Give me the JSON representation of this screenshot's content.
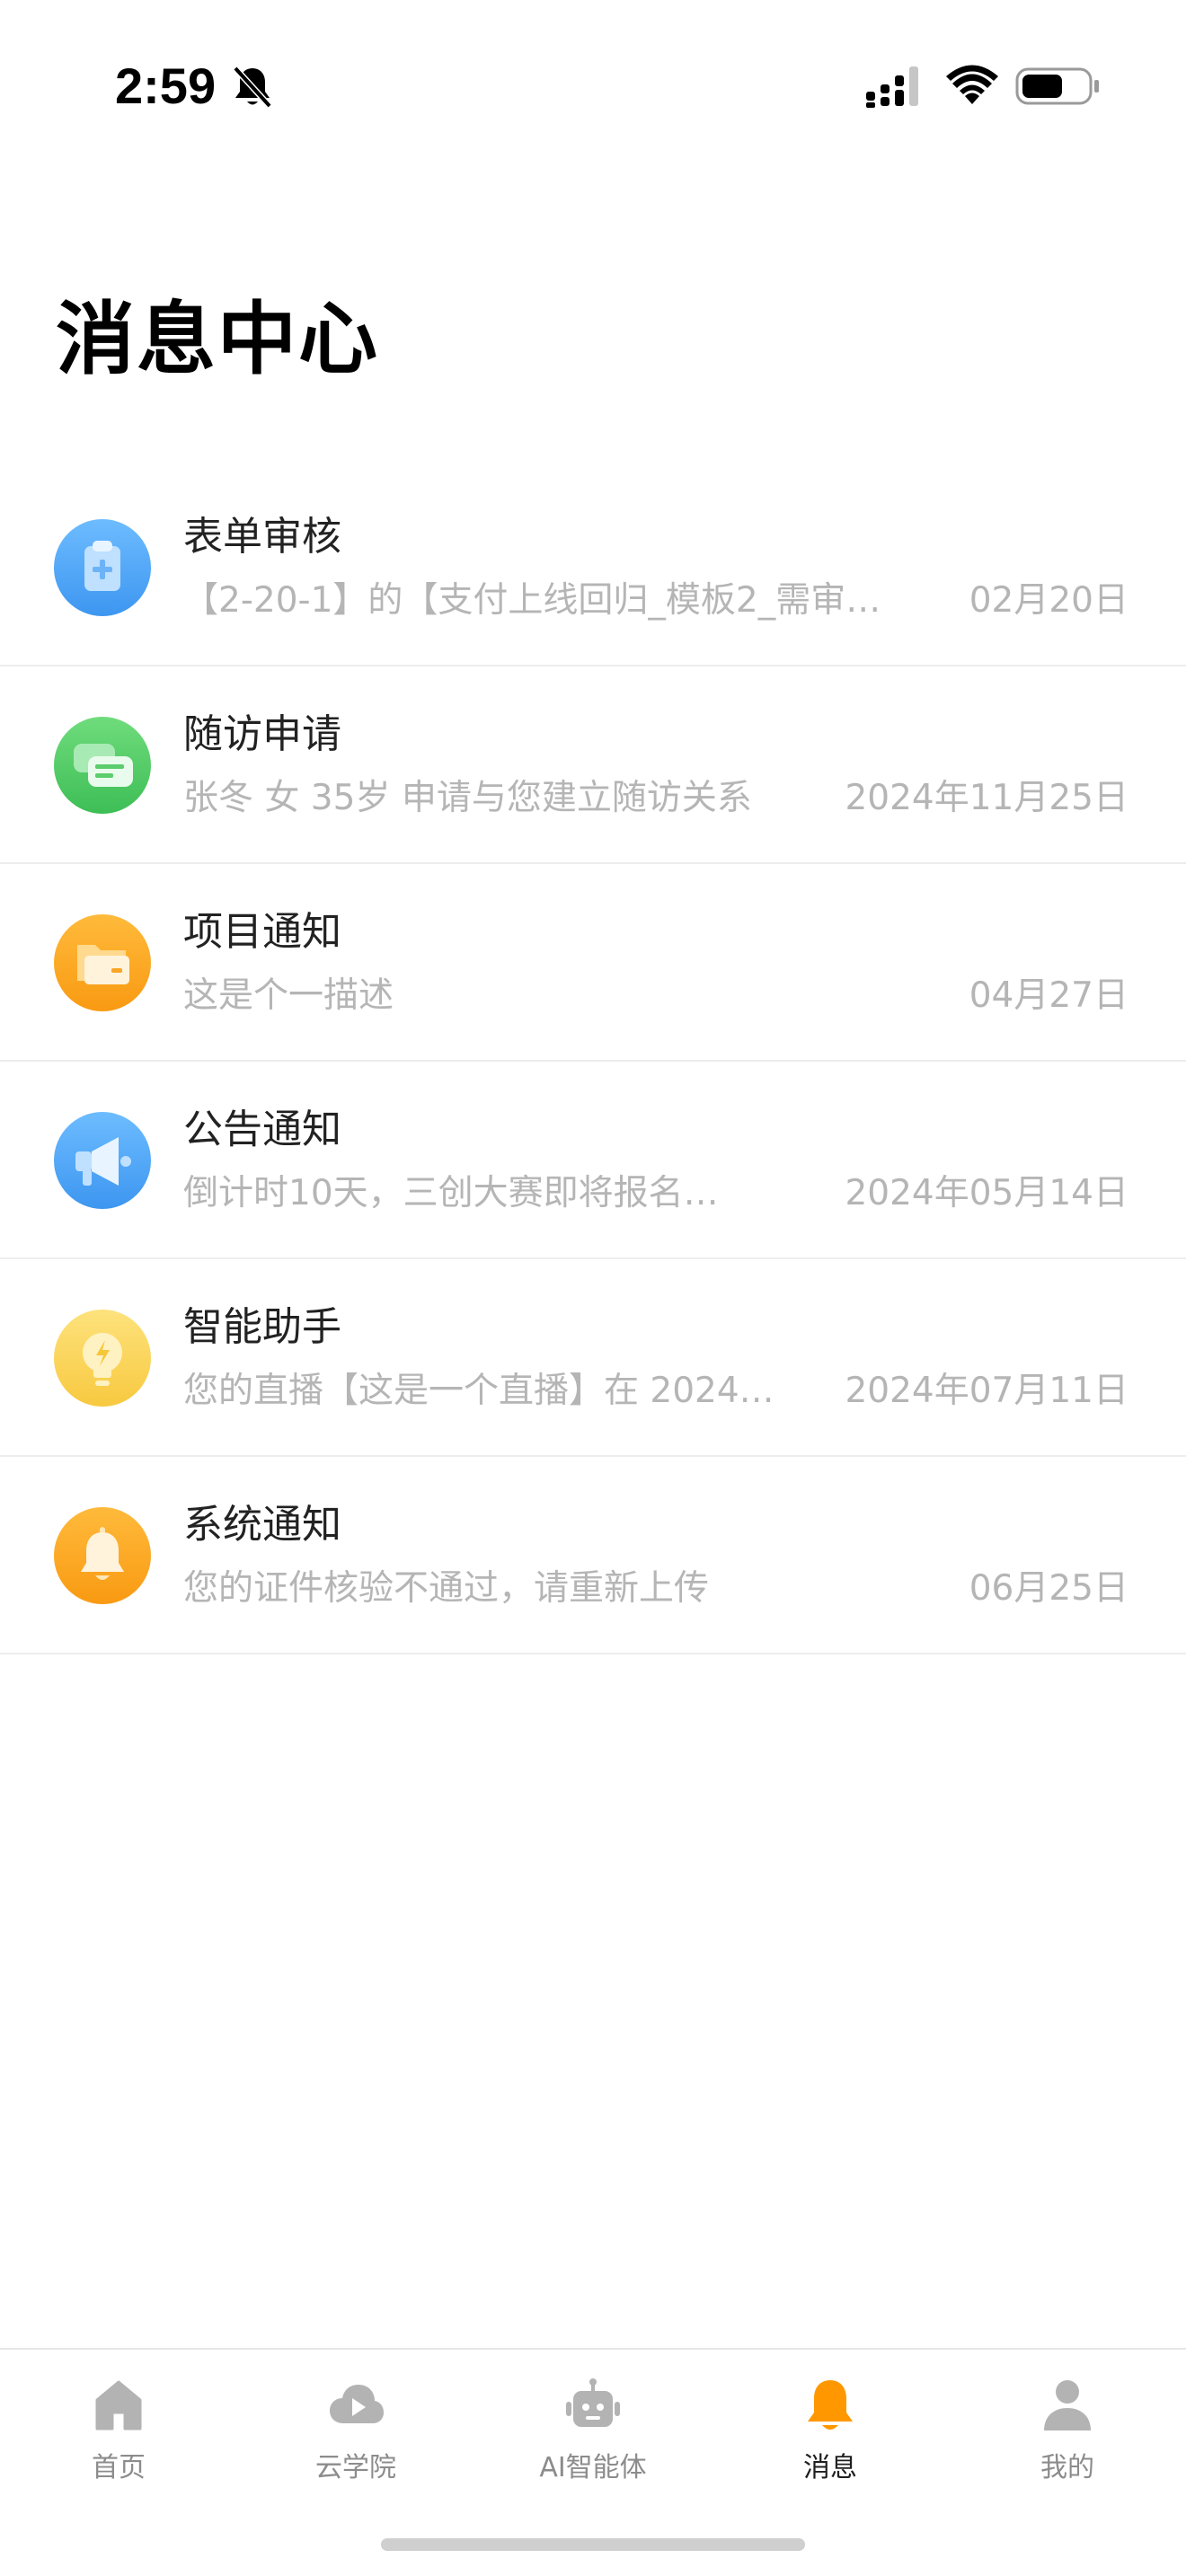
{
  "status_bar": {
    "time": "2:59",
    "icons": [
      "bell-off-icon",
      "cellular-icon",
      "wifi-icon",
      "battery-icon"
    ]
  },
  "page": {
    "title": "消息中心"
  },
  "messages": [
    {
      "title": "表单审核",
      "preview": "【2-20-1】的【支付上线回归_模板2_需审…",
      "date": "02月20日",
      "icon": "clipboard-icon",
      "color": "#4ea6f7"
    },
    {
      "title": "随访申请",
      "preview": "张冬 女 35岁 申请与您建立随访关系",
      "date": "2024年11月25日",
      "icon": "chat-icon",
      "color": "#4cc964"
    },
    {
      "title": "项目通知",
      "preview": "这是个一描述",
      "date": "04月27日",
      "icon": "folder-icon",
      "color": "#fca61f"
    },
    {
      "title": "公告通知",
      "preview": "倒计时10天，三创大赛即将报名…",
      "date": "2024年05月14日",
      "icon": "megaphone-icon",
      "color": "#4ea6f7"
    },
    {
      "title": "智能助手",
      "preview": "您的直播【这是一个直播】在 2024…",
      "date": "2024年07月11日",
      "icon": "lightbulb-icon",
      "color": "#fbd35a"
    },
    {
      "title": "系统通知",
      "preview": "您的证件核验不通过，请重新上传",
      "date": "06月25日",
      "icon": "bell-icon",
      "color": "#fca61f"
    }
  ],
  "tab_bar": {
    "active_color": "#ff9800",
    "inactive_color": "#b3b3b3",
    "tabs": [
      {
        "label": "首页",
        "icon": "home-icon",
        "active": false
      },
      {
        "label": "云学院",
        "icon": "cloud-play-icon",
        "active": false
      },
      {
        "label": "AI智能体",
        "icon": "robot-icon",
        "active": false
      },
      {
        "label": "消息",
        "icon": "bell-icon",
        "active": true
      },
      {
        "label": "我的",
        "icon": "person-icon",
        "active": false
      }
    ]
  }
}
